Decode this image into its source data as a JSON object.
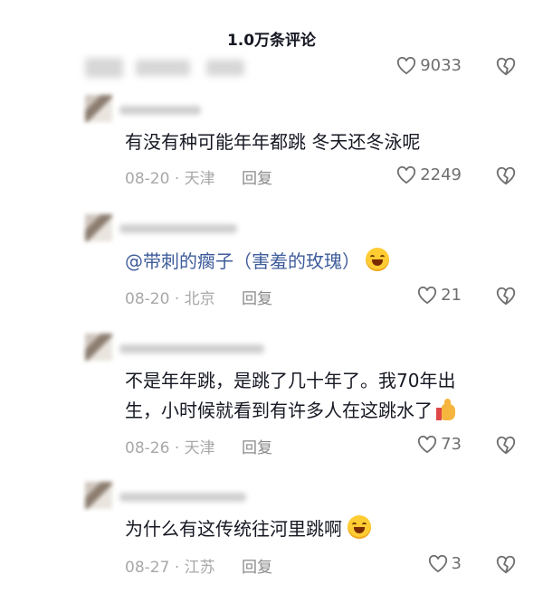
{
  "header": {
    "title": "1.0万条评论"
  },
  "top": {
    "likes": "9033"
  },
  "comments": [
    {
      "text_lines": [
        "有没有种可能年年都跳 冬天还冬泳呢"
      ],
      "date": "08-20",
      "location": "天津",
      "reply": "回复",
      "likes": "2249"
    },
    {
      "mention": "@带刺的瘸子（害羞的玫瑰）",
      "date": "08-20",
      "location": "北京",
      "reply": "回复",
      "likes": "21"
    },
    {
      "text_lines": [
        "不是年年跳，是跳了几十年了。我70年出",
        "生，小时候就看到有许多人在这跳水了"
      ],
      "date": "08-26",
      "location": "天津",
      "reply": "回复",
      "likes": "73"
    },
    {
      "text_lines": [
        "为什么有这传统往河里跳啊"
      ],
      "date": "08-27",
      "location": "江苏",
      "reply": "回复",
      "likes": "3"
    }
  ],
  "icons": {
    "like": "heart-outline-icon",
    "dislike": "broken-heart-icon",
    "emoji_laugh": "grin-sweat-emoji",
    "emoji_thumb": "thumbs-up-emoji"
  },
  "separator": "·"
}
